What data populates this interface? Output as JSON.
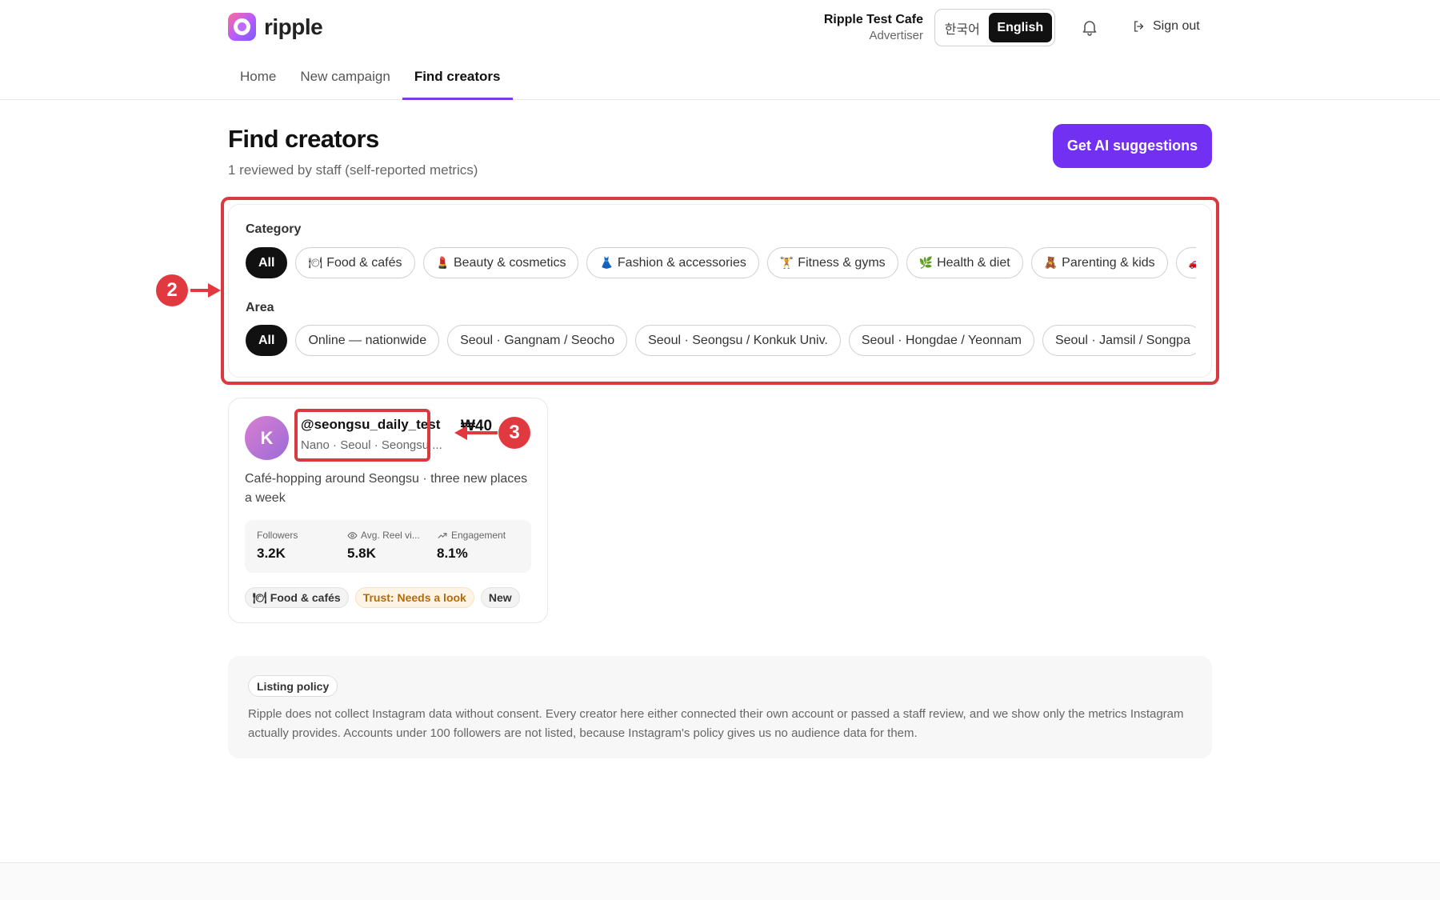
{
  "app": {
    "name": "ripple"
  },
  "account": {
    "name": "Ripple Test Cafe",
    "role": "Advertiser"
  },
  "language": {
    "options": [
      "한국어",
      "English"
    ],
    "selected": "English"
  },
  "header": {
    "sign_out": "Sign out"
  },
  "nav": {
    "tabs": [
      {
        "label": "Home"
      },
      {
        "label": "New campaign"
      },
      {
        "label": "Find creators"
      }
    ],
    "active": "Find creators"
  },
  "page": {
    "title": "Find creators",
    "subtitle": "1 reviewed by staff (self-reported metrics)",
    "ai_button": "Get AI suggestions"
  },
  "filters": {
    "category": {
      "label": "Category",
      "chips": [
        {
          "emoji": "",
          "label": "All",
          "selected": true
        },
        {
          "emoji": "🍽",
          "label": "Food & cafés"
        },
        {
          "emoji": "💄",
          "label": "Beauty & cosmetics"
        },
        {
          "emoji": "👗",
          "label": "Fashion & accessories"
        },
        {
          "emoji": "🏋",
          "label": "Fitness & gyms"
        },
        {
          "emoji": "🌿",
          "label": "Health & diet"
        },
        {
          "emoji": "🧸",
          "label": "Parenting & kids"
        },
        {
          "emoji": "🚗",
          "label": ""
        }
      ]
    },
    "area": {
      "label": "Area",
      "chips": [
        {
          "label": "All",
          "selected": true
        },
        {
          "label": "Online — nationwide"
        },
        {
          "label": "Seoul · Gangnam / Seocho"
        },
        {
          "label": "Seoul · Seongsu / Konkuk Univ."
        },
        {
          "label": "Seoul · Hongdae / Yeonnam"
        },
        {
          "label": "Seoul · Jamsil / Songpa"
        }
      ]
    }
  },
  "annotations": {
    "filters_badge": "2",
    "handle_badge": "3"
  },
  "creator": {
    "avatar_initial": "K",
    "handle": "@seongsu_daily_test",
    "meta": "Nano · Seoul · Seongsu ...",
    "price": "₩40",
    "bio": "Café-hopping around Seongsu · three new places a week",
    "stats": [
      {
        "label": "Followers",
        "value": "3.2K",
        "icon": ""
      },
      {
        "label": "Avg. Reel vi...",
        "value": "5.8K",
        "icon": "eye-icon"
      },
      {
        "label": "Engagement",
        "value": "8.1%",
        "icon": "trending-up-icon"
      }
    ],
    "tags": [
      {
        "emoji": "🍽",
        "label": "Food & cafés"
      },
      {
        "label": "Trust: Needs a look",
        "kind": "trust"
      },
      {
        "label": "New"
      }
    ]
  },
  "policy": {
    "tag": "Listing policy",
    "text": "Ripple does not collect Instagram data without consent. Every creator here either connected their own account or passed a staff review, and we show only the metrics Instagram actually provides. Accounts under 100 followers are not listed, because Instagram's policy gives us no audience data for them."
  },
  "colors": {
    "accent": "#7230f2",
    "annotation": "#d93a3f",
    "trust": "#b26b0a"
  }
}
